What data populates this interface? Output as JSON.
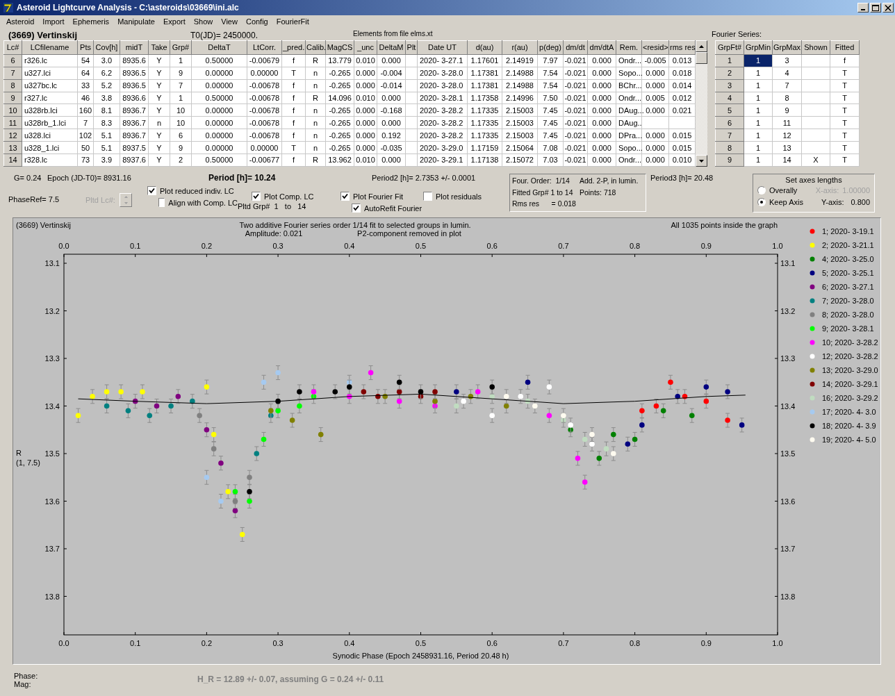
{
  "window": {
    "title": "Asteroid Lightcurve Analysis - C:\\asteroids\\03669\\ini.alc"
  },
  "menu": [
    "Asteroid",
    "Import",
    "Ephemeris",
    "Manipulate",
    "Export",
    "Show",
    "View",
    "Config",
    "FourierFit"
  ],
  "header": {
    "object": "(3669) Vertinskij",
    "t0": "T0(JD)= 2450000.",
    "elements": "Elements from file elms.xt",
    "fourier_title": "Fourier Series:"
  },
  "lc_table": {
    "columns": [
      "Lc#",
      "LCfilename",
      "Pts",
      "Cov[h]",
      "midT",
      "Take",
      "Grp#",
      "DeltaT",
      "LtCorr.",
      "_pred.",
      "Calib.",
      "MagCS",
      "_unc",
      "DeltaM",
      "Plt",
      "Date UT",
      "d(au)",
      "r(au)",
      "p(deg)",
      "dm/dt",
      "dm/dtA",
      "Rem.",
      "<resid>",
      "rms res"
    ],
    "rows": [
      [
        "6",
        "r326.lc",
        "54",
        "3.0",
        "8935.6",
        "Y",
        "1",
        "0.50000",
        "-0.00679",
        "f",
        "R",
        "13.779",
        "0.010",
        "0.000",
        null,
        "2020- 3-27.1",
        "1.17601",
        "2.14919",
        "7.97",
        "-0.021",
        "0.000",
        "Ondr...",
        "-0.005",
        "0.013"
      ],
      [
        "7",
        "u327.lci",
        "64",
        "6.2",
        "8936.5",
        "Y",
        "9",
        "0.00000",
        "0.00000",
        "T",
        "n",
        "-0.265",
        "0.000",
        "-0.004",
        null,
        "2020- 3-28.0",
        "1.17381",
        "2.14988",
        "7.54",
        "-0.021",
        "0.000",
        "Sopo...",
        "0.000",
        "0.018"
      ],
      [
        "8",
        "u327bc.lc",
        "33",
        "5.2",
        "8936.5",
        "Y",
        "7",
        "0.00000",
        "-0.00678",
        "f",
        "n",
        "-0.265",
        "0.000",
        "-0.014",
        null,
        "2020- 3-28.0",
        "1.17381",
        "2.14988",
        "7.54",
        "-0.021",
        "0.000",
        "BChr...",
        "0.000",
        "0.014"
      ],
      [
        "9",
        "r327.lc",
        "46",
        "3.8",
        "8936.6",
        "Y",
        "1",
        "0.50000",
        "-0.00678",
        "f",
        "R",
        "14.096",
        "0.010",
        "0.000",
        null,
        "2020- 3-28.1",
        "1.17358",
        "2.14996",
        "7.50",
        "-0.021",
        "0.000",
        "Ondr...",
        "0.005",
        "0.012"
      ],
      [
        "10",
        "u328rb.lci",
        "160",
        "8.1",
        "8936.7",
        "Y",
        "10",
        "0.00000",
        "-0.00678",
        "f",
        "n",
        "-0.265",
        "0.000",
        "-0.168",
        null,
        "2020- 3-28.2",
        "1.17335",
        "2.15003",
        "7.45",
        "-0.021",
        "0.000",
        "DAug...",
        "0.000",
        "0.021"
      ],
      [
        "11",
        "u328rb_1.lci",
        "7",
        "8.3",
        "8936.7",
        "n",
        "10",
        "0.00000",
        "-0.00678",
        "f",
        "n",
        "-0.265",
        "0.000",
        "0.000",
        null,
        "2020- 3-28.2",
        "1.17335",
        "2.15003",
        "7.45",
        "-0.021",
        "0.000",
        "DAug..",
        null,
        null
      ],
      [
        "12",
        "u328.lci",
        "102",
        "5.1",
        "8936.7",
        "Y",
        "6",
        "0.00000",
        "-0.00678",
        "f",
        "n",
        "-0.265",
        "0.000",
        "0.192",
        null,
        "2020- 3-28.2",
        "1.17335",
        "2.15003",
        "7.45",
        "-0.021",
        "0.000",
        "DPra...",
        "0.000",
        "0.015"
      ],
      [
        "13",
        "u328_1.lci",
        "50",
        "5.1",
        "8937.5",
        "Y",
        "9",
        "0.00000",
        "0.00000",
        "T",
        "n",
        "-0.265",
        "0.000",
        "-0.035",
        null,
        "2020- 3-29.0",
        "1.17159",
        "2.15064",
        "7.08",
        "-0.021",
        "0.000",
        "Sopo...",
        "0.000",
        "0.015"
      ],
      [
        "14",
        "r328.lc",
        "73",
        "3.9",
        "8937.6",
        "Y",
        "2",
        "0.50000",
        "-0.00677",
        "f",
        "R",
        "13.962",
        "0.010",
        "0.000",
        null,
        "2020- 3-29.1",
        "1.17138",
        "2.15072",
        "7.03",
        "-0.021",
        "0.000",
        "Ondr...",
        "0.000",
        "0.010"
      ]
    ]
  },
  "fourier_table": {
    "columns": [
      "GrpFt#",
      "GrpMin",
      "GrpMax",
      "Shown",
      "Fitted"
    ],
    "rows": [
      {
        "cells": [
          "1",
          "1",
          "3",
          null,
          "f"
        ],
        "selected": true
      },
      {
        "cells": [
          "2",
          "1",
          "4",
          null,
          "T"
        ],
        "selected": false
      },
      {
        "cells": [
          "3",
          "1",
          "7",
          null,
          "T"
        ],
        "selected": false
      },
      {
        "cells": [
          "4",
          "1",
          "8",
          null,
          "T"
        ],
        "selected": false
      },
      {
        "cells": [
          "5",
          "1",
          "9",
          null,
          "T"
        ],
        "selected": false
      },
      {
        "cells": [
          "6",
          "1",
          "11",
          null,
          "T"
        ],
        "selected": false
      },
      {
        "cells": [
          "7",
          "1",
          "12",
          null,
          "T"
        ],
        "selected": false
      },
      {
        "cells": [
          "8",
          "1",
          "13",
          null,
          "T"
        ],
        "selected": false
      },
      {
        "cells": [
          "9",
          "1",
          "14",
          "X",
          "T"
        ],
        "selected": false
      }
    ]
  },
  "params": {
    "g": "G= 0.24",
    "epoch": "Epoch (JD-T0)= 8931.16",
    "period": "Period [h]= 10.24",
    "period2": "Period2 [h]= 2.7353 +/- 0.0001",
    "phase_ref": "PhaseRef= 7.5",
    "period3": "Period3 [h]= 20.48"
  },
  "pltd_lc": {
    "label": "Pltd Lc#:",
    "disabled": true
  },
  "checkbox_groups": [
    {
      "items": [
        {
          "label": "Plot reduced indiv. LC",
          "checked": true
        },
        {
          "label": "Align with Comp. LC",
          "checked": false
        }
      ]
    },
    {
      "items": [
        {
          "label": "Plot Comp. LC",
          "checked": true
        }
      ],
      "note": "Pltd Grp#  1   to   14"
    },
    {
      "items": [
        {
          "label": "Plot Fourier Fit",
          "checked": true
        },
        {
          "label": "AutoRefit Fourier",
          "checked": true
        }
      ]
    },
    {
      "items": [
        {
          "label": "Plot residuals",
          "checked": false
        }
      ]
    }
  ],
  "fourier_info": [
    [
      "Four. Order:  1/14",
      "Add. 2-P, in lumin."
    ],
    [
      "Fitted Grp# 1 to 14",
      "Points: 718"
    ],
    [
      "Rms res      = 0.018"
    ]
  ],
  "axes_box": {
    "title": "Set axes lengths",
    "options": [
      {
        "label": "Overally",
        "selected": false,
        "field_label": "X-axis:",
        "value": "1.00000",
        "disabled": true
      },
      {
        "label": "Keep Axis",
        "selected": true,
        "field_label": "Y-axis:",
        "value": "0.800",
        "disabled": false
      }
    ]
  },
  "plot": {
    "object_label": "(3669) Vertinskij",
    "top_tick_labels": [
      "0.0",
      "0.1",
      "0.2",
      "0.3",
      "0.4",
      "0.5",
      "0.6",
      "0.7",
      "0.8",
      "0.9",
      "1.0"
    ],
    "right_tick_labels": [
      "13.1",
      "13.2",
      "13.3",
      "13.4",
      "13.5",
      "13.6",
      "13.7",
      "13.8"
    ],
    "subtitles": [
      "Amplitude: 0.021",
      "P2-component removed in plot"
    ],
    "points_note": "All 1035 points inside the graph",
    "ylabel_sub": "(1, 7.5)",
    "chart_data": {
      "type": "scatter",
      "title": "Two additive Fourier series order 1/14 fit to selected groups in lumin.",
      "xlabel": "Synodic Phase (Epoch 2458931.16, Period 20.48 h)",
      "ylabel": "R",
      "xlim": [
        0,
        1
      ],
      "ylim": [
        13.881,
        13.081
      ],
      "legend": "right",
      "xticks": [
        {
          "value": 0,
          "label": "0.0"
        },
        0.1,
        0.2,
        0.3,
        0.4,
        0.5,
        0.6,
        0.7,
        0.8,
        0.9,
        {
          "value": 1,
          "label": "1.0"
        }
      ],
      "yticks": [
        {
          "value": 13.1,
          "label": "13.1"
        },
        {
          "value": 13.2,
          "label": "13.2"
        },
        {
          "value": 13.3,
          "label": "13.3"
        },
        {
          "value": 13.4,
          "label": "13.4"
        },
        {
          "value": 13.5,
          "label": "13.5"
        },
        {
          "value": 13.6,
          "label": "13.6"
        },
        {
          "value": 13.7,
          "label": "13.7"
        },
        {
          "value": 13.8,
          "label": "13.8"
        }
      ],
      "series": [
        {
          "name": "1; 2020- 3-19.1",
          "color": "#ff0000",
          "x": [
            0.81,
            0.83,
            0.85,
            0.87,
            0.9,
            0.93
          ],
          "values": [
            13.41,
            13.4,
            13.35,
            13.38,
            13.39,
            13.43
          ]
        },
        {
          "name": "2; 2020- 3-21.1",
          "color": "#ffff00",
          "x": [
            0.02,
            0.04,
            0.06,
            0.08,
            0.11,
            0.2,
            0.21,
            0.23,
            0.25
          ],
          "values": [
            13.42,
            13.38,
            13.37,
            13.37,
            13.37,
            13.36,
            13.46,
            13.58,
            13.67
          ]
        },
        {
          "name": "4; 2020- 3-25.0",
          "color": "#008000",
          "x": [
            0.71,
            0.75,
            0.77,
            0.8,
            0.84,
            0.88
          ],
          "values": [
            13.45,
            13.51,
            13.46,
            13.47,
            13.41,
            13.42
          ]
        },
        {
          "name": "5; 2020- 3-25.1",
          "color": "#000080",
          "x": [
            0.55,
            0.65,
            0.79,
            0.81,
            0.86,
            0.9,
            0.93,
            0.95
          ],
          "values": [
            13.37,
            13.35,
            13.48,
            13.44,
            13.38,
            13.36,
            13.37,
            13.44
          ]
        },
        {
          "name": "6; 2020- 3-27.1",
          "color": "#800080",
          "x": [
            0.1,
            0.13,
            0.16,
            0.2,
            0.22,
            0.24
          ],
          "values": [
            13.39,
            13.4,
            13.38,
            13.45,
            13.52,
            13.62
          ]
        },
        {
          "name": "7; 2020- 3-28.0",
          "color": "#008080",
          "x": [
            0.06,
            0.09,
            0.12,
            0.15,
            0.18,
            0.27,
            0.29
          ],
          "values": [
            13.4,
            13.41,
            13.42,
            13.4,
            13.39,
            13.5,
            13.42
          ]
        },
        {
          "name": "8; 2020- 3-28.0",
          "color": "#808080",
          "x": [
            0.19,
            0.21,
            0.24,
            0.26
          ],
          "values": [
            13.42,
            13.49,
            13.6,
            13.55
          ]
        },
        {
          "name": "9; 2020- 3-28.1",
          "color": "#00ff00",
          "x": [
            0.24,
            0.26,
            0.28,
            0.3,
            0.33,
            0.35
          ],
          "values": [
            13.58,
            13.6,
            13.47,
            13.41,
            13.4,
            13.38
          ]
        },
        {
          "name": "10; 2020- 3-28.2",
          "color": "#ff00ff",
          "x": [
            0.35,
            0.4,
            0.43,
            0.47,
            0.52,
            0.58,
            0.68,
            0.72,
            0.73
          ],
          "values": [
            13.37,
            13.38,
            13.33,
            13.39,
            13.4,
            13.37,
            13.42,
            13.51,
            13.56
          ]
        },
        {
          "name": "12; 2020- 3-28.2",
          "color": "#ffffff",
          "x": [
            0.56,
            0.6,
            0.64,
            0.68,
            0.71,
            0.74
          ],
          "values": [
            13.39,
            13.42,
            13.38,
            13.36,
            13.44,
            13.48
          ]
        },
        {
          "name": "13; 2020- 3-29.0",
          "color": "#808000",
          "x": [
            0.29,
            0.32,
            0.36,
            0.45,
            0.52,
            0.57,
            0.62
          ],
          "values": [
            13.41,
            13.43,
            13.46,
            13.38,
            13.39,
            13.38,
            13.4
          ]
        },
        {
          "name": "14; 2020- 3-29.1",
          "color": "#800000",
          "x": [
            0.42,
            0.44,
            0.47,
            0.5,
            0.52
          ],
          "values": [
            13.37,
            13.38,
            13.37,
            13.38,
            13.37
          ]
        },
        {
          "name": "16; 2020- 3-29.2",
          "color": "#c0dcc0",
          "x": [
            0.55,
            0.6,
            0.65,
            0.7,
            0.73,
            0.76
          ],
          "values": [
            13.4,
            13.38,
            13.39,
            13.43,
            13.47,
            13.49
          ]
        },
        {
          "name": "17; 2020- 4- 3.0",
          "color": "#a6caf0",
          "x": [
            0.2,
            0.22,
            0.28,
            0.3,
            0.4
          ],
          "values": [
            13.55,
            13.6,
            13.35,
            13.33,
            13.35
          ]
        },
        {
          "name": "18; 2020- 4- 3.9",
          "color": "#000000",
          "x": [
            0.26,
            0.3,
            0.33,
            0.38,
            0.4,
            0.47,
            0.5,
            0.6
          ],
          "values": [
            13.58,
            13.39,
            13.37,
            13.37,
            13.36,
            13.35,
            13.37,
            13.36
          ]
        },
        {
          "name": "19; 2020- 4- 5.0",
          "color": "#fffbf0",
          "x": [
            0.62,
            0.66,
            0.7,
            0.74,
            0.77
          ],
          "values": [
            13.38,
            13.4,
            13.42,
            13.46,
            13.5
          ]
        },
        {
          "type": "line",
          "color": "#000000",
          "x": [
            0.02,
            0.1,
            0.2,
            0.3,
            0.4,
            0.5,
            0.6,
            0.7,
            0.8,
            0.9,
            0.955
          ],
          "values": [
            13.385,
            13.39,
            13.395,
            13.39,
            13.38,
            13.375,
            13.385,
            13.395,
            13.39,
            13.38,
            13.377
          ]
        }
      ]
    }
  },
  "status": {
    "phase_label": "Phase:",
    "mag_label": "Mag:",
    "result": "H_R = 12.89 +/- 0.07, assuming G = 0.24 +/- 0.11"
  }
}
